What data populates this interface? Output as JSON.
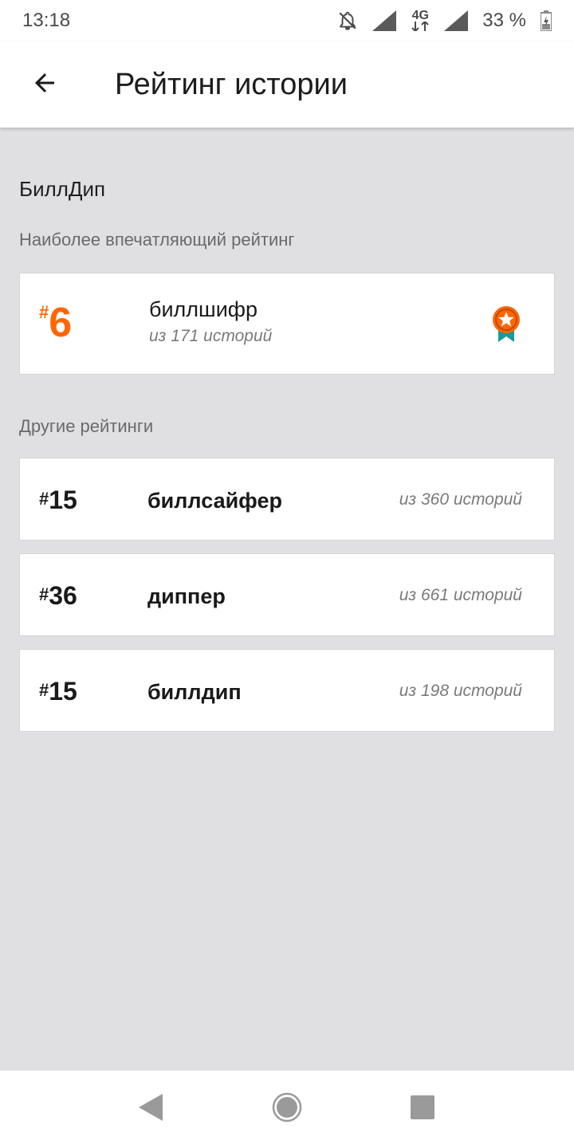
{
  "status_bar": {
    "time": "13:18",
    "network": "4G",
    "battery": "33 %",
    "icons": [
      "notifications-off-icon",
      "signal-icon",
      "network-4g-icon",
      "signal-icon",
      "battery-icon"
    ]
  },
  "app_bar": {
    "back_icon": "arrow-back-icon",
    "title": "Рейтинг истории"
  },
  "profile": {
    "name": "БиллДип"
  },
  "best_section": {
    "label": "Наиболее впечатляющий рейтинг",
    "rank_hash": "#",
    "rank": "6",
    "tag": "биллшифр",
    "sub": "из 171 историй",
    "badge_icon": "ribbon-star-icon",
    "accent_color": "#ff6600"
  },
  "other_section": {
    "label": "Другие рейтинги",
    "items": [
      {
        "rank_hash": "#",
        "rank": "15",
        "tag": "биллсайфер",
        "sub": "из 360 историй"
      },
      {
        "rank_hash": "#",
        "rank": "36",
        "tag": "диппер",
        "sub": "из 661 историй"
      },
      {
        "rank_hash": "#",
        "rank": "15",
        "tag": "биллдип",
        "sub": "из 198 историй"
      }
    ]
  },
  "nav_bar": {
    "icons": [
      "nav-back-icon",
      "nav-home-icon",
      "nav-recents-icon"
    ]
  }
}
